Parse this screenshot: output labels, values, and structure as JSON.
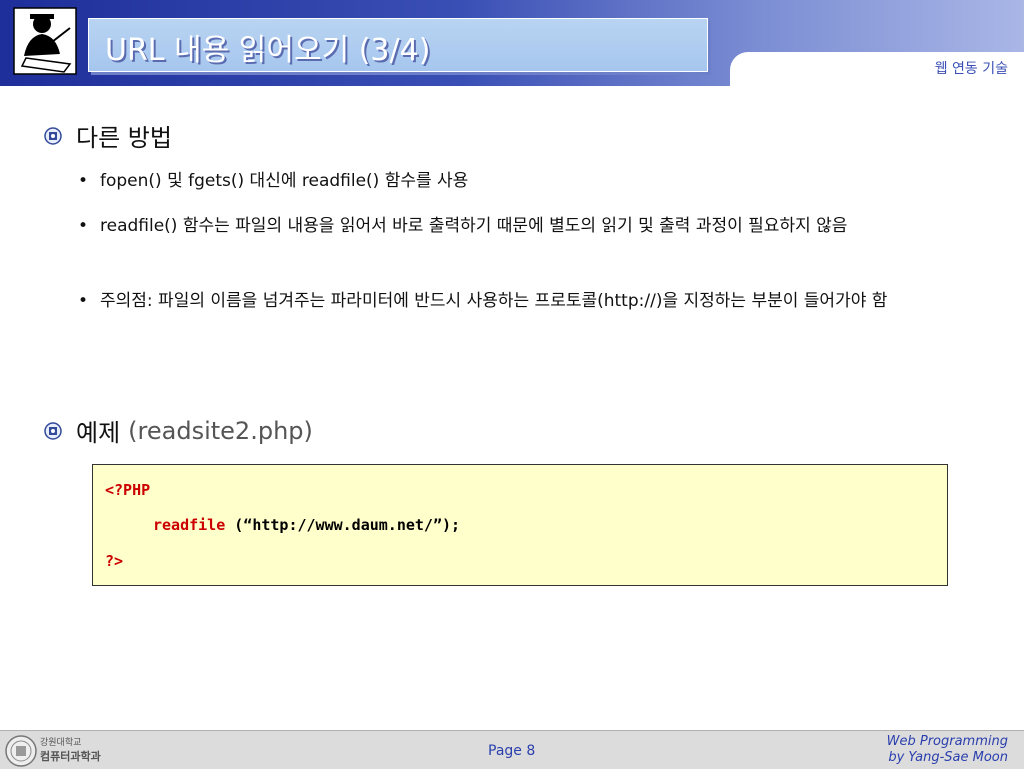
{
  "header": {
    "title": "URL 내용 읽어오기 (3/4)",
    "course": "웹 연동 기술"
  },
  "sections": [
    {
      "heading": "다른 방법",
      "bullets": [
        "fopen() 및 fgets() 대신에 readfile() 함수를 사용",
        "readfile() 함수는 파일의 내용을 읽어서 바로 출력하기 때문에 별도의 읽기 및 출력 과정이 필요하지 않음",
        "주의점: 파일의 이름을 넘겨주는 파라미터에 반드시 사용하는 프로토콜(http://)을 지정하는 부분이 들어가야 함"
      ]
    },
    {
      "heading": "예제",
      "subheading": "(readsite2.php)"
    }
  ],
  "code": {
    "open_tag": "<?PHP",
    "func": "readfile",
    "args": " (“http://www.daum.net/”);",
    "close_tag": "?>"
  },
  "footer": {
    "dept_line1": "강원대학교",
    "dept_line2": "컴퓨터과학과",
    "page": "Page 8",
    "author_line1": "Web Programming",
    "author_line2": "by Yang-Sae Moon"
  },
  "colors": {
    "header_dark": "#1e2e9a",
    "title_box": "#a6c6ee",
    "code_bg": "#ffffcc",
    "code_keyword": "#cc0000",
    "footer_text": "#2a3fae"
  }
}
